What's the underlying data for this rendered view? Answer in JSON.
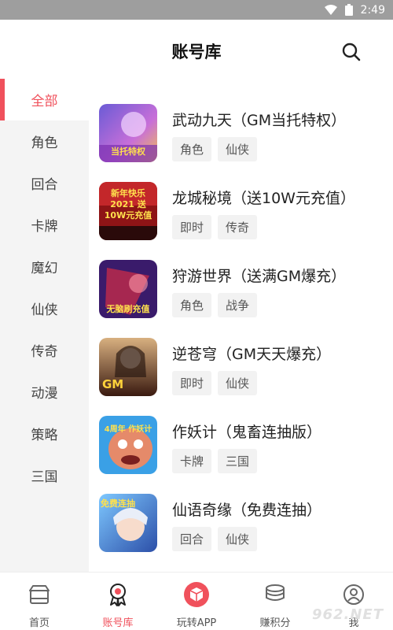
{
  "status_bar": {
    "time": "2:49"
  },
  "header": {
    "title": "账号库"
  },
  "sidebar": {
    "items": [
      {
        "label": "全部",
        "active": true
      },
      {
        "label": "角色"
      },
      {
        "label": "回合"
      },
      {
        "label": "卡牌"
      },
      {
        "label": "魔幻"
      },
      {
        "label": "仙侠"
      },
      {
        "label": "传奇"
      },
      {
        "label": "动漫"
      },
      {
        "label": "策略"
      },
      {
        "label": "三国"
      }
    ]
  },
  "games": [
    {
      "name": "武动九天（GM当托特权）",
      "tags": [
        "角色",
        "仙侠"
      ],
      "icon_text": "当托特权"
    },
    {
      "name": "龙城秘境（送10W元充值）",
      "tags": [
        "即时",
        "传奇"
      ],
      "icon_text": "新年快乐 2021 送10W元充值"
    },
    {
      "name": "狩游世界（送满GM爆充）",
      "tags": [
        "角色",
        "战争"
      ],
      "icon_text": "无脑刷充值"
    },
    {
      "name": "逆苍穹（GM天天爆充）",
      "tags": [
        "即时",
        "仙侠"
      ],
      "icon_text": "GM"
    },
    {
      "name": "作妖计（鬼畜连抽版）",
      "tags": [
        "卡牌",
        "三国"
      ],
      "icon_text": "4周年 作妖计"
    },
    {
      "name": "仙语奇缘（免费连抽）",
      "tags": [
        "回合",
        "仙侠"
      ],
      "icon_text": "免费连抽"
    }
  ],
  "tabbar": {
    "items": [
      {
        "label": "首页",
        "icon": "store-icon"
      },
      {
        "label": "账号库",
        "icon": "medal-icon",
        "active": true
      },
      {
        "label": "玩转APP",
        "icon": "cube-icon"
      },
      {
        "label": "赚积分",
        "icon": "coins-icon"
      },
      {
        "label": "我",
        "icon": "user-icon"
      }
    ]
  },
  "watermark": "962.NET",
  "colors": {
    "accent": "#f0515c",
    "status_bar": "#9e9e9e",
    "sidebar_bg": "#f4f4f4",
    "tag_bg": "#f2f2f2"
  }
}
